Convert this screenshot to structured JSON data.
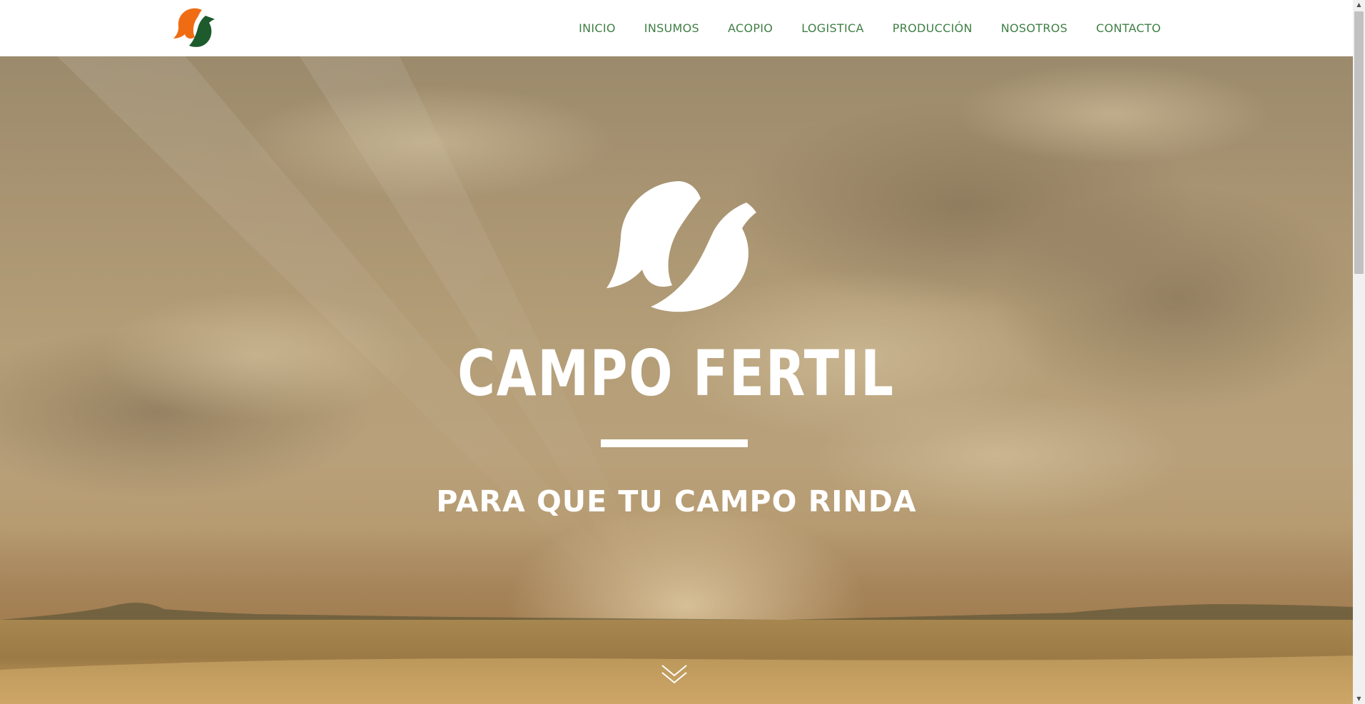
{
  "brand": {
    "logo_icon": "campo-fertil-leaf-logo",
    "colors": {
      "orange": "#ef6c13",
      "green": "#1d5a2c",
      "nav_text": "#3f7f45"
    }
  },
  "nav": {
    "items": [
      {
        "label": "INICIO"
      },
      {
        "label": "INSUMOS"
      },
      {
        "label": "ACOPIO"
      },
      {
        "label": "LOGISTICA"
      },
      {
        "label": "PRODUCCIÓN"
      },
      {
        "label": "NOSOTROS"
      },
      {
        "label": "CONTACTO"
      }
    ]
  },
  "hero": {
    "title": "CAMPO FERTIL",
    "tagline": "PARA QUE TU CAMPO RINDA",
    "scroll_icon": "double-chevron-down-icon",
    "background": "sunset-wheat-field-photo"
  }
}
